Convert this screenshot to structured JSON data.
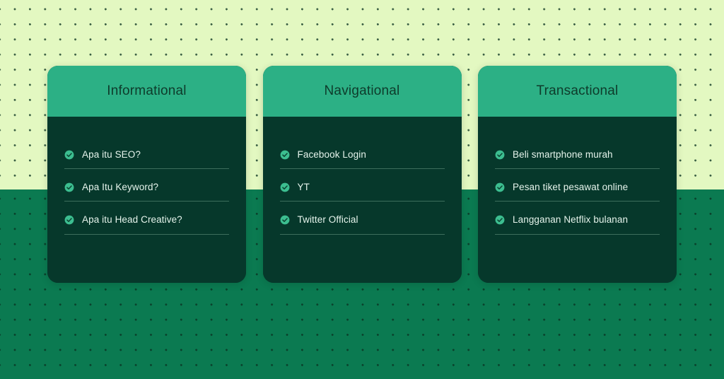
{
  "background": {
    "top_color": "#E3F8C1",
    "bottom_color": "#0B7A51",
    "dot_color": "#123A26",
    "pattern": "polka-dot-grid"
  },
  "theme": {
    "card_header_color": "#2CB085",
    "card_body_color": "#06382B",
    "card_title_color": "#0E3B2B",
    "item_text_color": "#E6F4EC",
    "check_circle_color": "#3CBE90",
    "check_mark_color": "#0B4532",
    "divider_color": "rgba(190,235,205,0.30)"
  },
  "cards": [
    {
      "title": "Informational",
      "items": [
        {
          "icon": "check-circle-icon",
          "label": "Apa itu SEO?"
        },
        {
          "icon": "check-circle-icon",
          "label": "Apa Itu Keyword?"
        },
        {
          "icon": "check-circle-icon",
          "label": "Apa itu Head Creative?"
        }
      ]
    },
    {
      "title": "Navigational",
      "items": [
        {
          "icon": "check-circle-icon",
          "label": "Facebook Login"
        },
        {
          "icon": "check-circle-icon",
          "label": "YT"
        },
        {
          "icon": "check-circle-icon",
          "label": "Twitter Official"
        }
      ]
    },
    {
      "title": "Transactional",
      "items": [
        {
          "icon": "check-circle-icon",
          "label": "Beli smartphone murah"
        },
        {
          "icon": "check-circle-icon",
          "label": "Pesan tiket pesawat online"
        },
        {
          "icon": "check-circle-icon",
          "label": "Langganan Netflix bulanan"
        }
      ]
    }
  ]
}
